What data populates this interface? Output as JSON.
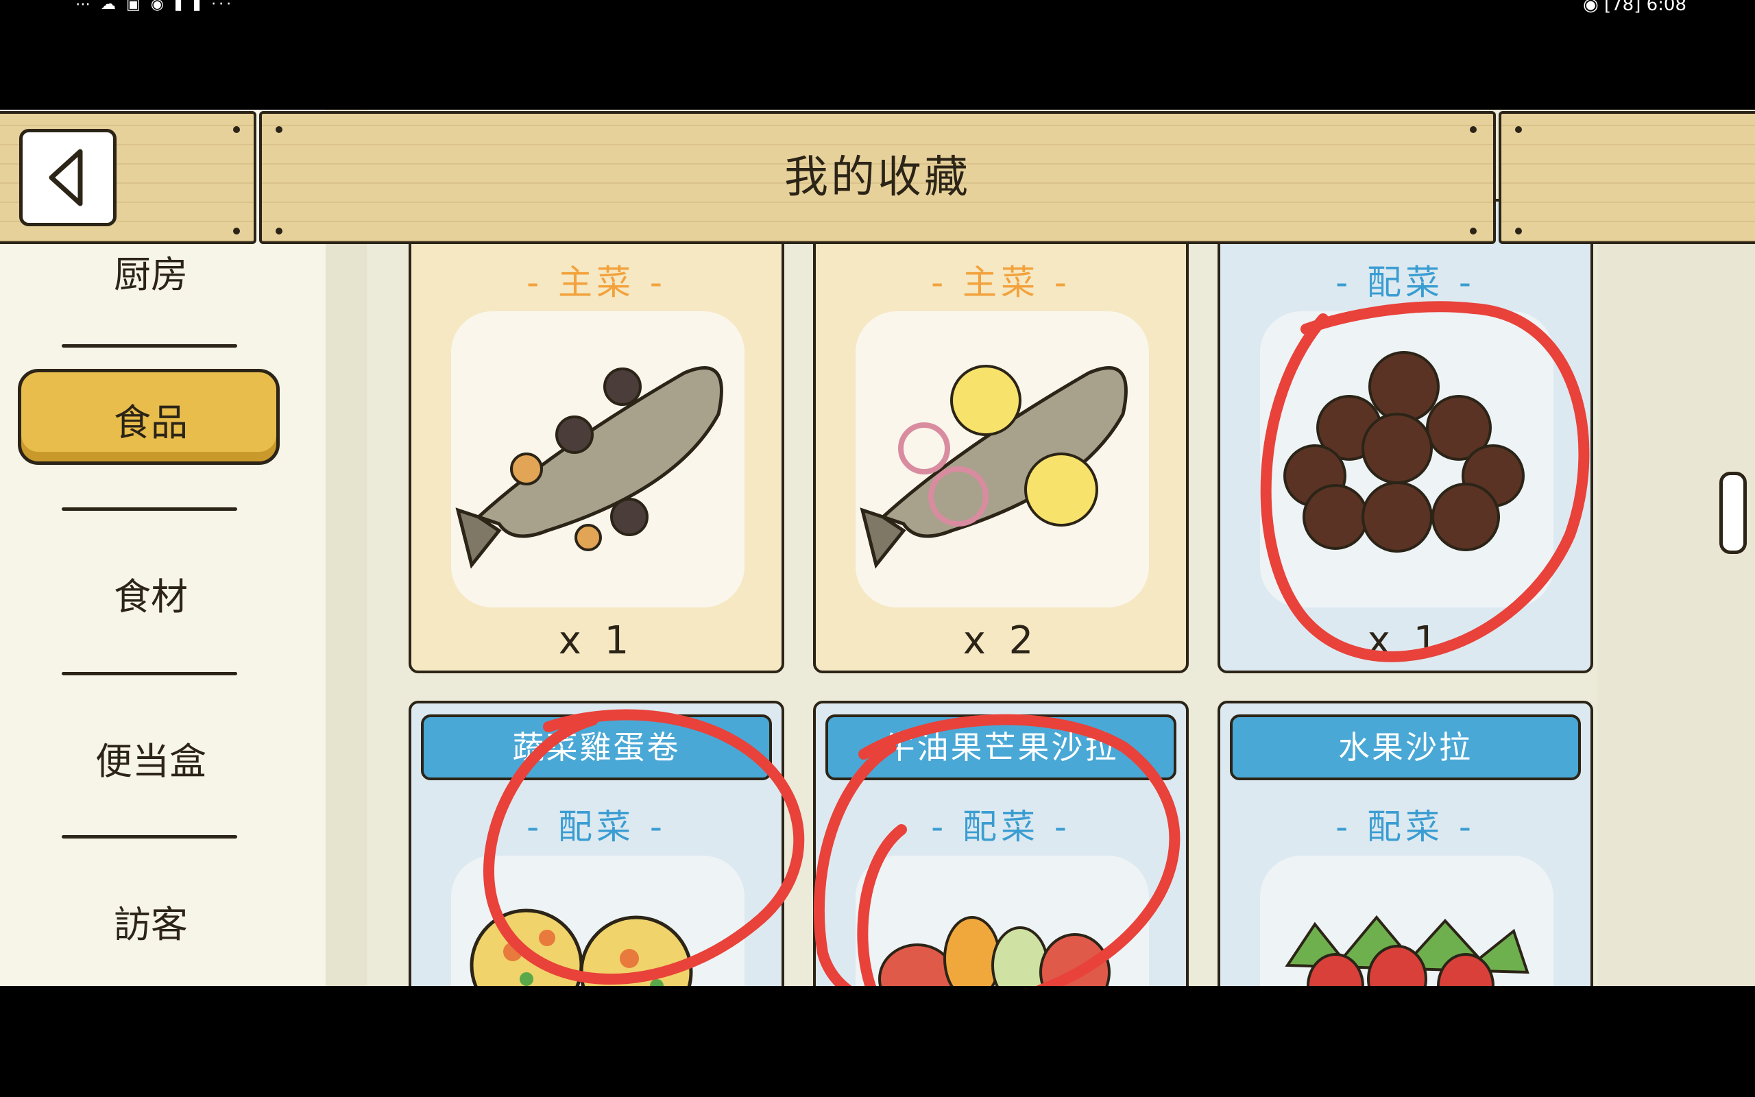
{
  "status_bar": {
    "time": "6:08",
    "battery": "78"
  },
  "header": {
    "title": "我的收藏"
  },
  "sidebar": {
    "items": [
      {
        "label": "厨房"
      },
      {
        "label": "食品",
        "active": true
      },
      {
        "label": "食材"
      },
      {
        "label": "便当盒"
      },
      {
        "label": "訪客"
      }
    ]
  },
  "grid": {
    "row1": [
      {
        "category": "- 主菜 -",
        "quantity": "x 1",
        "dish": "fish-with-mushrooms"
      },
      {
        "category": "- 主菜 -",
        "quantity": "x 2",
        "dish": "fish-with-lemon"
      },
      {
        "category": "- 配菜 -",
        "quantity": "x 1",
        "dish": "meatballs"
      }
    ],
    "row2": [
      {
        "name": "蔬菜雞蛋卷",
        "category": "- 配菜 -",
        "dish": "veggie-egg-roll"
      },
      {
        "name": "牛油果芒果沙拉",
        "category": "- 配菜 -",
        "dish": "avocado-mango-salad"
      },
      {
        "name": "水果沙拉",
        "category": "- 配菜 -",
        "dish": "fruit-salad"
      }
    ]
  },
  "colors": {
    "main_category": "#f2a23c",
    "side_category": "#3a9dd2",
    "annotation": "#e8423a",
    "active_tab": "#e8bd4c"
  }
}
